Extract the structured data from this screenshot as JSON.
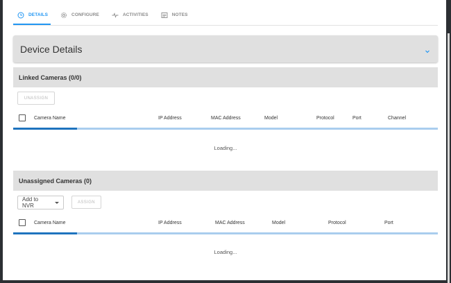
{
  "tabs": [
    {
      "label": "DETAILS",
      "icon": "clock-icon",
      "active": true
    },
    {
      "label": "CONFIGURE",
      "icon": "gear-icon",
      "active": false
    },
    {
      "label": "ACTIVITIES",
      "icon": "pulse-icon",
      "active": false
    },
    {
      "label": "NOTES",
      "icon": "notes-icon",
      "active": false
    }
  ],
  "device_details": {
    "title": "Device Details",
    "expand_icon": "chevron-down-icon"
  },
  "linked": {
    "title": "Linked Cameras (0/0)",
    "unassign_label": "UNASSIGN",
    "columns": [
      "Camera Name",
      "IP Address",
      "MAC Address",
      "Model",
      "Protocol",
      "Port",
      "Channel"
    ],
    "progress": 0.15,
    "loading_text": "Loading..."
  },
  "unassigned": {
    "title": "Unassigned Cameras (0)",
    "add_to_nvr_label": "Add to NVR",
    "assign_label": "ASSIGN",
    "columns": [
      "Camera Name",
      "IP Address",
      "MAC Address",
      "Model",
      "Protocol",
      "Port"
    ],
    "progress": 0.15,
    "loading_text": "Loading..."
  },
  "colors": {
    "accent": "#2196f3",
    "header_bg": "#e0e0e0",
    "progress_track": "#a9cdee",
    "progress_bar": "#1e73be"
  }
}
